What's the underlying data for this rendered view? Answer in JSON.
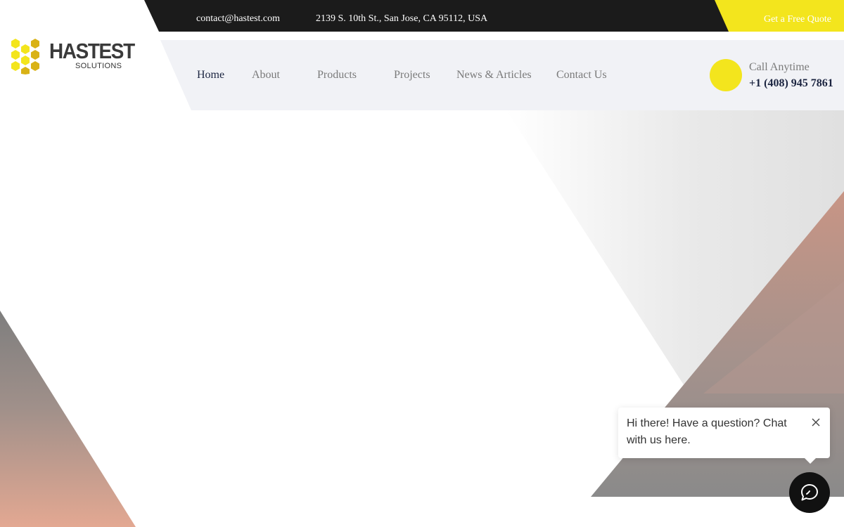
{
  "topbar": {
    "email": "contact@hastest.com",
    "address": "2139 S. 10th St., San Jose, CA 95112, USA",
    "quote_label": "Get a Free Quote"
  },
  "logo": {
    "wordmark": "HASTEST",
    "subtitle": "SOLUTIONS",
    "icon": "honeycomb-logo-icon"
  },
  "nav": {
    "items": [
      {
        "label": "Home",
        "active": true
      },
      {
        "label": "About",
        "active": false
      },
      {
        "label": "Products",
        "active": false
      },
      {
        "label": "Projects",
        "active": false
      },
      {
        "label": "News & Articles",
        "active": false
      },
      {
        "label": "Contact Us",
        "active": false
      }
    ]
  },
  "call": {
    "label": "Call Anytime",
    "phone": "+1 (408) 945 7861"
  },
  "chat": {
    "message": "Hi there! Have a question? Chat with us here.",
    "close_icon": "close-icon",
    "launcher_icon": "chat-icon"
  },
  "colors": {
    "accent_yellow": "#f3e51d",
    "topbar_dark": "#1b1b1b",
    "nav_band": "#f1f2f6",
    "nav_active": "#1b2440",
    "nav_text": "#7a7a7a"
  }
}
